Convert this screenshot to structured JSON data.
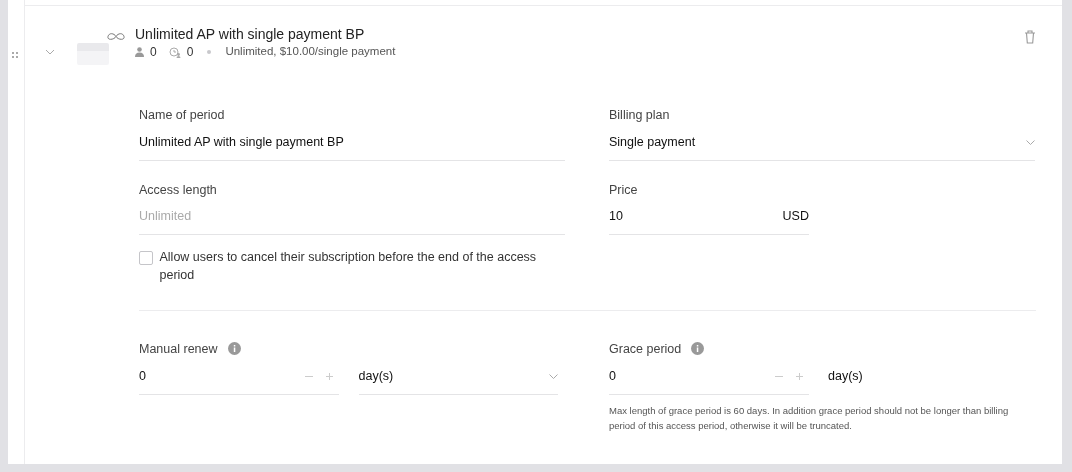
{
  "period": {
    "title": "Unlimited AP with single payment BP",
    "users": "0",
    "renewals": "0",
    "summary": "Unlimited, $10.00/single payment",
    "expanded": true
  },
  "name_field": {
    "label": "Name of period",
    "value": "Unlimited AP with single payment BP"
  },
  "billing_plan": {
    "label": "Billing plan",
    "value": "Single payment"
  },
  "access_length": {
    "label": "Access length",
    "value": "Unlimited",
    "disabled": true
  },
  "price": {
    "label": "Price",
    "value": "10",
    "currency": "USD"
  },
  "allow_cancel": {
    "label": "Allow users to cancel their subscription before the end of the access period",
    "checked": false
  },
  "manual_renew": {
    "label": "Manual renew",
    "value": "0",
    "unit": "day(s)"
  },
  "grace_period": {
    "label": "Grace period",
    "value": "0",
    "unit": "day(s)",
    "hint": "Max length of grace period is 60 days. In addition grace period should not be longer than billing period of this access period, otherwise it will be truncated."
  }
}
